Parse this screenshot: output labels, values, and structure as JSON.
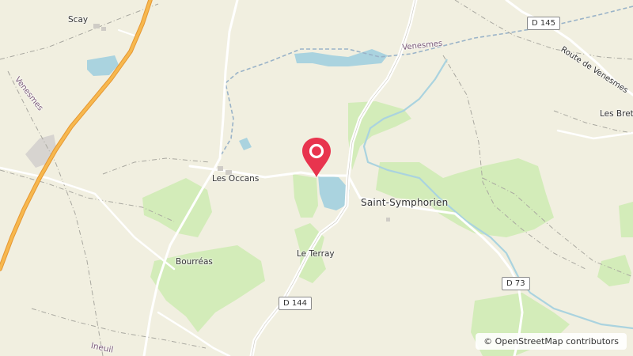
{
  "map": {
    "colors": {
      "background": "#f1efe0",
      "forest": "#d3ecb9",
      "water": "#aad3df",
      "marker": "#e8344e"
    },
    "places": {
      "scay": "Scay",
      "les_occans": "Les Occans",
      "bourreas": "Bourréas",
      "le_terray": "Le Terray",
      "saint_symphorien": "Saint-Symphorien",
      "les_breteaux": "Les Brete",
      "ineuil": "Ineuil"
    },
    "waterways": {
      "venesmes_river": "Venesmes",
      "venesmes_stream_west": "Venesmes"
    },
    "roads": {
      "d145": "D 145",
      "d73": "D 73",
      "d144": "D 144",
      "route_de_venesmes": "Route de Venesmes"
    },
    "marker_icon": "map-pin-icon",
    "attribution": "© OpenStreetMap contributors"
  }
}
